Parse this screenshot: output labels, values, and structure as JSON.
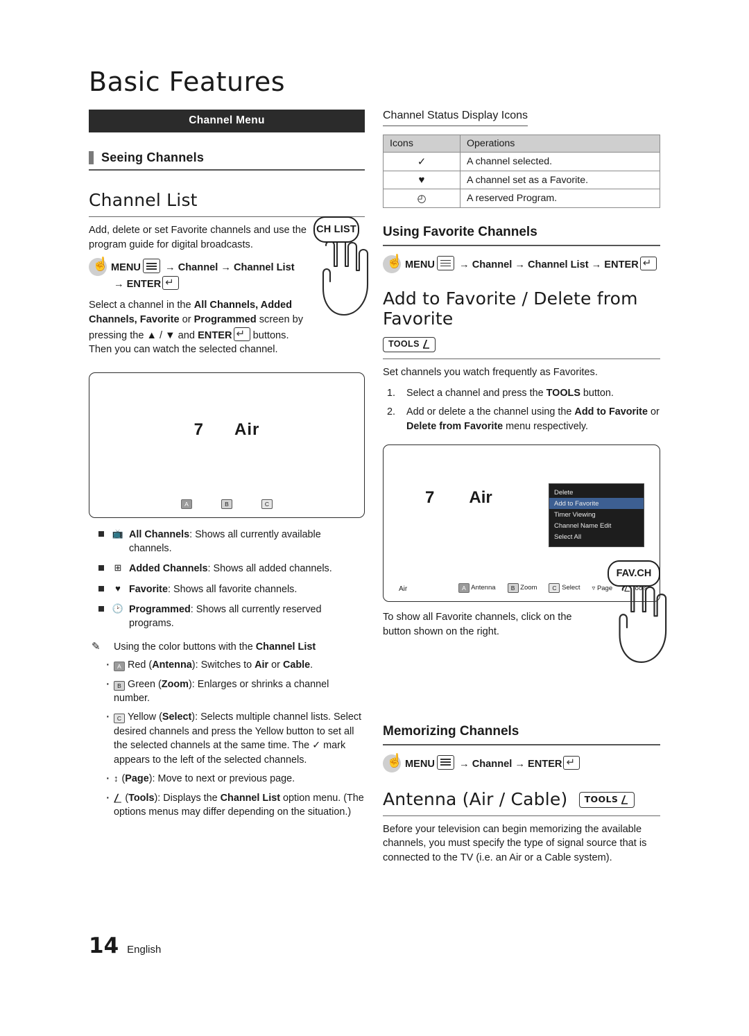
{
  "page": {
    "title": "Basic Features",
    "number": "14",
    "language": "English"
  },
  "left": {
    "menu_bar": "Channel Menu",
    "seeing_channels": "Seeing Channels",
    "channel_list_title": "Channel List",
    "intro": "Add, delete or set Favorite channels and use the program guide for digital broadcasts.",
    "path_menu": "MENU",
    "path_arrow1": "→",
    "path_channel": "Channel",
    "path_channel_list": "Channel List",
    "path_arrow2": "→",
    "path_enter": "ENTER",
    "select_para_1": "Select a channel in the ",
    "select_bold_1": "All Channels, Added Channels, Favorite",
    "select_para_2": " or ",
    "select_bold_2": "Programmed",
    "select_para_3": " screen by pressing the ▲ / ▼ and ",
    "select_bold_3": "ENTER",
    "select_para_4": " buttons. Then you can watch the selected channel.",
    "chlist_button": "CH LIST",
    "tv_sample": {
      "channel_number": "7",
      "channel_name": "Air"
    },
    "bullets": [
      {
        "icon": "all-channels-icon",
        "label": "All Channels",
        "text": ": Shows all currently available channels."
      },
      {
        "icon": "added-channels-icon",
        "label": "Added Channels",
        "text": ": Shows all added channels."
      },
      {
        "icon": "favorite-icon",
        "label": "Favorite",
        "text": ": Shows all favorite channels."
      },
      {
        "icon": "programmed-icon",
        "label": "Programmed",
        "text": ": Shows all currently reserved programs."
      }
    ],
    "note_intro_pre": "Using the color buttons with the ",
    "note_intro_bold": "Channel List",
    "color_buttons": [
      {
        "key": "A",
        "color": "red",
        "name": "Red",
        "paren_open": " (",
        "bold": "Antenna",
        "paren_close": "): Switches to ",
        "bold2": "Air",
        "mid": " or ",
        "bold3": "Cable",
        "tail": "."
      },
      {
        "key": "B",
        "color": "green",
        "name": "Green",
        "paren_open": " (",
        "bold": "Zoom",
        "paren_close": "): Enlarges or shrinks a channel number.",
        "bold2": "",
        "mid": "",
        "bold3": "",
        "tail": ""
      },
      {
        "key": "C",
        "color": "yellow",
        "name": "Yellow",
        "paren_open": " (",
        "bold": "Select",
        "paren_close": "): Selects multiple channel lists. Select desired channels and press the Yellow button to set all the selected channels at the same time. The ✓ mark appears to the left of the selected channels.",
        "bold2": "",
        "mid": "",
        "bold3": "",
        "tail": ""
      },
      {
        "key": "page",
        "color": "none",
        "name": "",
        "paren_open": "(",
        "bold": "Page",
        "paren_close": "): Move to next or previous page.",
        "bold2": "",
        "mid": "",
        "bold3": "",
        "tail": ""
      },
      {
        "key": "tools",
        "color": "none",
        "name": "",
        "paren_open": "(",
        "bold": "Tools",
        "paren_close": "): Displays the ",
        "bold2": "Channel List",
        "mid": " option menu. (The options menus may differ depending on the situation.)",
        "bold3": "",
        "tail": ""
      }
    ]
  },
  "right": {
    "status_heading": "Channel Status Display Icons",
    "status_table": {
      "headers": [
        "Icons",
        "Operations"
      ],
      "rows": [
        {
          "icon": "✓",
          "operation": "A channel selected."
        },
        {
          "icon": "♥",
          "operation": "A channel set as a Favorite."
        },
        {
          "icon": "◴",
          "operation": "A reserved Program."
        }
      ]
    },
    "using_favorite_title": "Using Favorite Channels",
    "fav_path": {
      "menu": "MENU",
      "arrow1": "→",
      "channel": "Channel",
      "arrow2": "→",
      "channel_list": "Channel List",
      "arrow3": "→",
      "enter": "ENTER"
    },
    "add_fav_title": "Add to Favorite / Delete from Favorite",
    "tools_chip": "TOOLS",
    "set_channels_text": "Set channels you watch frequently as Favorites.",
    "steps": [
      {
        "pre": "Select a channel and press the ",
        "bold": "TOOLS",
        "post": " button."
      },
      {
        "pre": "Add or delete a the channel using the ",
        "bold": "Add to Favorite",
        "mid": " or ",
        "bold2": "Delete from Favorite",
        "post": " menu respectively."
      }
    ],
    "tv_sample2": {
      "channel_number": "7",
      "channel_name": "Air",
      "air_label": "Air",
      "popup_items": [
        "Delete",
        "Add to Favorite",
        "Timer Viewing",
        "Channel Name Edit",
        "Select All"
      ],
      "popup_selected_index": 1,
      "footer_keys": [
        {
          "key": "A",
          "color": "red",
          "label": "Antenna"
        },
        {
          "key": "B",
          "color": "green",
          "label": "Zoom"
        },
        {
          "key": "C",
          "color": "yellow",
          "label": "Select"
        },
        {
          "key": "↕",
          "color": "none",
          "label": "Page"
        },
        {
          "key": "T",
          "color": "none",
          "label": "Tools"
        }
      ]
    },
    "favch_text": "To show all Favorite channels, click on the button shown on the right.",
    "favch_button": "FAV.CH",
    "memorizing_title": "Memorizing Channels",
    "mem_path": {
      "menu": "MENU",
      "arrow1": "→",
      "channel": "Channel",
      "arrow2": "→",
      "enter": "ENTER"
    },
    "antenna_title": "Antenna (Air / Cable)",
    "antenna_tools": "TOOLS",
    "antenna_text": "Before your television can begin memorizing the available channels, you must specify the type of signal source that is connected to the TV (i.e. an Air or a Cable system)."
  }
}
